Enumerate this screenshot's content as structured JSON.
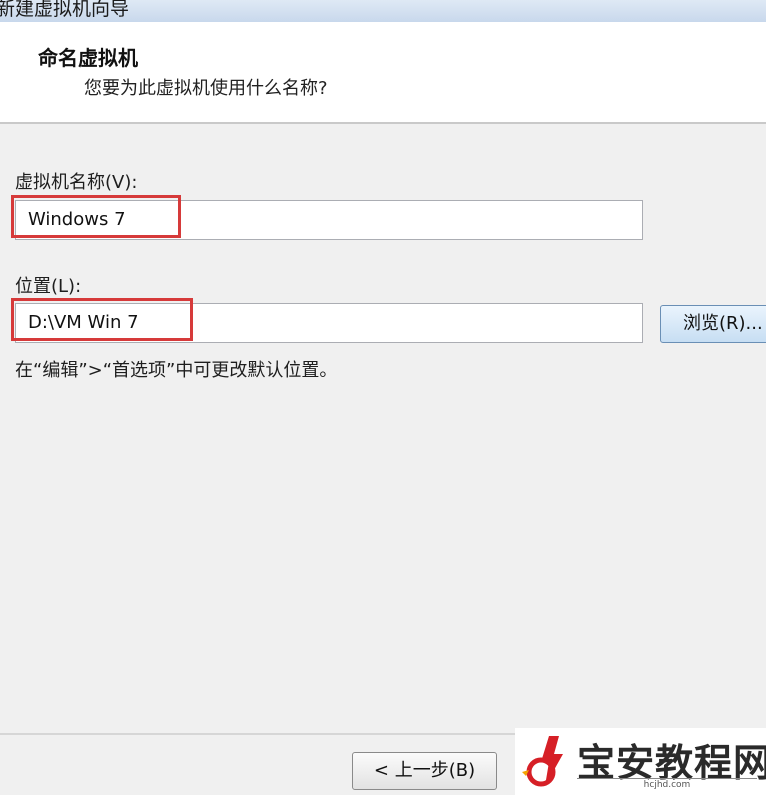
{
  "window": {
    "title": "新建虚拟机向导"
  },
  "header": {
    "title": "命名虚拟机",
    "subtitle": "您要为此虚拟机使用什么名称?"
  },
  "form": {
    "name_label": "虚拟机名称(V):",
    "name_value": "Windows 7",
    "location_label": "位置(L):",
    "location_value": "D:\\VM Win 7",
    "browse_label": "浏览(R)...",
    "hint": "在“编辑”>“首选项”中可更改默认位置。"
  },
  "footer": {
    "back_label": "< 上一步(B)"
  },
  "watermark": {
    "text": "宝安教程网",
    "url": "hcjhd.com"
  },
  "colors": {
    "highlight": "#d63a3a",
    "button_blue": "#c7def3"
  }
}
